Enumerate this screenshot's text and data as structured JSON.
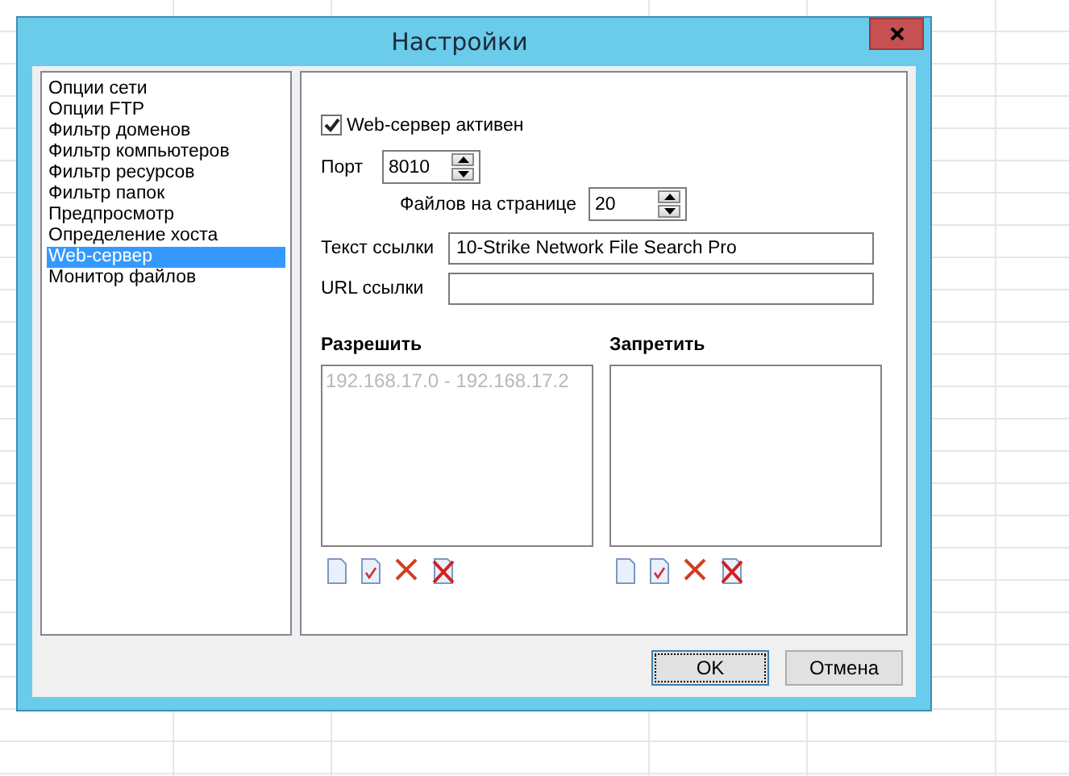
{
  "window": {
    "title": "Настройки"
  },
  "sidebar": {
    "items": [
      {
        "label": "Опции сети",
        "selected": false
      },
      {
        "label": "Опции FTP",
        "selected": false
      },
      {
        "label": "Фильтр доменов",
        "selected": false
      },
      {
        "label": "Фильтр компьютеров",
        "selected": false
      },
      {
        "label": "Фильтр ресурсов",
        "selected": false
      },
      {
        "label": "Фильтр папок",
        "selected": false
      },
      {
        "label": "Предпросмотр",
        "selected": false
      },
      {
        "label": "Определение хоста",
        "selected": false
      },
      {
        "label": "Web-сервер",
        "selected": true
      },
      {
        "label": "Монитор файлов",
        "selected": false
      }
    ]
  },
  "web_server": {
    "enabled": {
      "label": "Web-сервер активен",
      "checked": true
    },
    "port": {
      "label": "Порт",
      "value": "8010"
    },
    "files_per_page": {
      "label": "Файлов на странице",
      "value": "20"
    },
    "link_text": {
      "label": "Текст ссылки",
      "value": "10-Strike Network File Search Pro"
    },
    "link_url": {
      "label": "URL ссылки"
    },
    "allow": {
      "title": "Разрешить",
      "items": [
        {
          "label": "192.168.17.0 - 192.168.17.2",
          "disabled": true
        }
      ]
    },
    "deny": {
      "title": "Запретить"
    }
  },
  "buttons": [
    {
      "label": "OK",
      "focused": true
    },
    {
      "label": "Отмена",
      "focused": false
    }
  ]
}
